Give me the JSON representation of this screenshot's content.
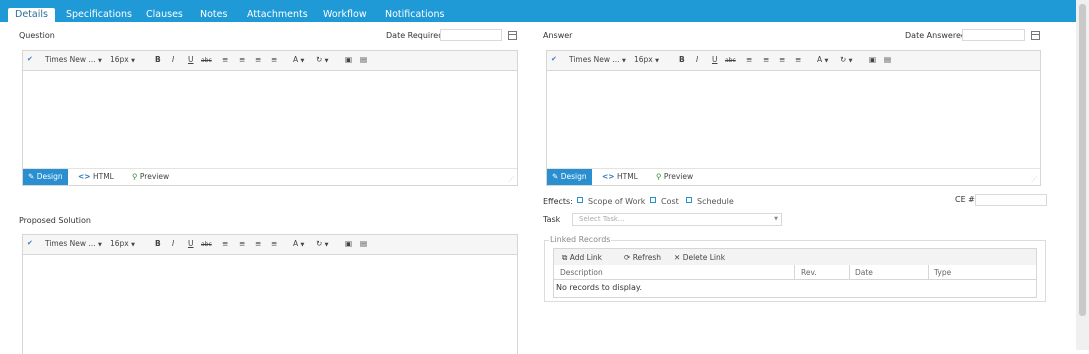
{
  "tabs": [
    "Details",
    "Specifications",
    "Clauses",
    "Notes",
    "Attachments",
    "Workflow",
    "Notifications"
  ],
  "question": {
    "label": "Question",
    "date_label": "Date Required",
    "date_value": ""
  },
  "answer": {
    "label": "Answer",
    "date_label": "Date Answered",
    "date_value": ""
  },
  "proposed": {
    "label": "Proposed Solution"
  },
  "editor": {
    "font": "Times New ...",
    "size": "16px",
    "bold": "B",
    "italic": "I",
    "underline": "U",
    "strike": "abc",
    "fontcolor": "A",
    "modes": [
      "Design",
      "HTML",
      "Preview"
    ]
  },
  "effects": {
    "label": "Effects:",
    "options": [
      "Scope of Work",
      "Cost",
      "Schedule"
    ]
  },
  "ce": {
    "label": "CE #",
    "value": ""
  },
  "task": {
    "label": "Task",
    "placeholder": "Select Task..."
  },
  "linked": {
    "legend": "Linked Records",
    "buttons": [
      "Add Link",
      "Refresh",
      "Delete Link"
    ],
    "columns": [
      "Description",
      "Rev.",
      "Date",
      "Type"
    ],
    "empty": "No records to display."
  },
  "colors": {
    "accent": "#1f9ad6",
    "mode_active": "#2a8fd0"
  },
  "icons": [
    "spellcheck-icon",
    "image-icon",
    "document-icon",
    "calendar-icon",
    "pencil-icon",
    "code-icon",
    "magnifier-icon",
    "add-link-icon",
    "refresh-icon",
    "delete-icon"
  ]
}
